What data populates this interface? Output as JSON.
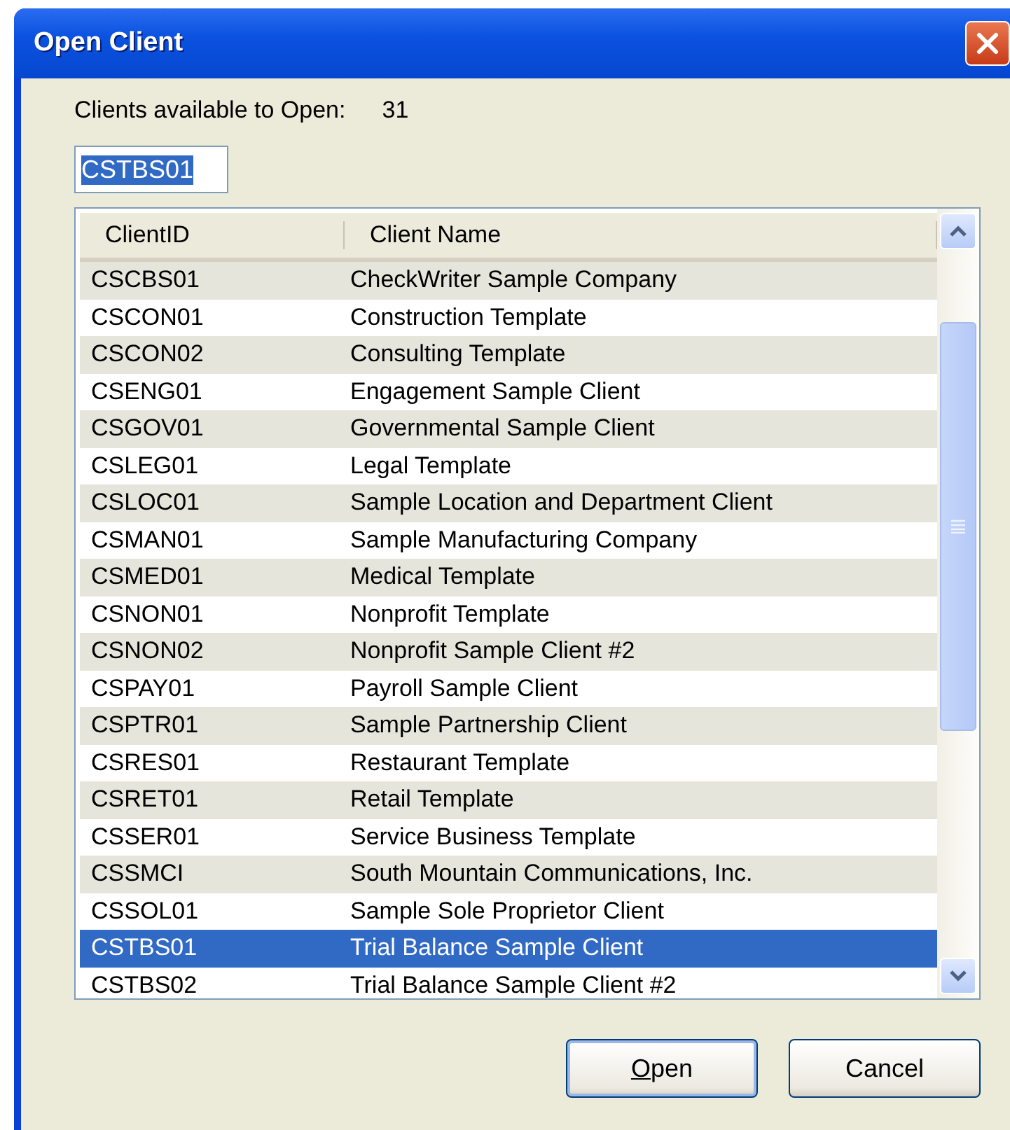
{
  "window": {
    "title": "Open Client"
  },
  "summary": {
    "label": "Clients available to Open:",
    "count": "31"
  },
  "search": {
    "value": "CSTBS01",
    "text_selected": true
  },
  "table": {
    "columns": [
      "ClientID",
      "Client Name"
    ],
    "rows": [
      {
        "id": "CSCBS01",
        "name": "CheckWriter Sample Company",
        "selected": false
      },
      {
        "id": "CSCON01",
        "name": "Construction Template",
        "selected": false
      },
      {
        "id": "CSCON02",
        "name": "Consulting Template",
        "selected": false
      },
      {
        "id": "CSENG01",
        "name": "Engagement Sample Client",
        "selected": false
      },
      {
        "id": "CSGOV01",
        "name": "Governmental Sample Client",
        "selected": false
      },
      {
        "id": "CSLEG01",
        "name": "Legal Template",
        "selected": false
      },
      {
        "id": "CSLOC01",
        "name": "Sample Location and Department Client",
        "selected": false
      },
      {
        "id": "CSMAN01",
        "name": "Sample Manufacturing Company",
        "selected": false
      },
      {
        "id": "CSMED01",
        "name": "Medical Template",
        "selected": false
      },
      {
        "id": "CSNON01",
        "name": "Nonprofit Template",
        "selected": false
      },
      {
        "id": "CSNON02",
        "name": "Nonprofit Sample Client #2",
        "selected": false
      },
      {
        "id": "CSPAY01",
        "name": "Payroll Sample Client",
        "selected": false
      },
      {
        "id": "CSPTR01",
        "name": "Sample Partnership Client",
        "selected": false
      },
      {
        "id": "CSRES01",
        "name": "Restaurant Template",
        "selected": false
      },
      {
        "id": "CSRET01",
        "name": "Retail Template",
        "selected": false
      },
      {
        "id": "CSSER01",
        "name": "Service Business Template",
        "selected": false
      },
      {
        "id": "CSSMCI",
        "name": "South Mountain Communications, Inc.",
        "selected": false
      },
      {
        "id": "CSSOL01",
        "name": "Sample Sole Proprietor Client",
        "selected": false
      },
      {
        "id": "CSTBS01",
        "name": "Trial Balance Sample Client",
        "selected": true
      },
      {
        "id": "CSTBS02",
        "name": "Trial Balance Sample Client #2",
        "selected": false
      }
    ]
  },
  "buttons": [
    {
      "label": "Open",
      "first_letter_underlined": true,
      "default": true
    },
    {
      "label": "Cancel",
      "default": false
    }
  ]
}
